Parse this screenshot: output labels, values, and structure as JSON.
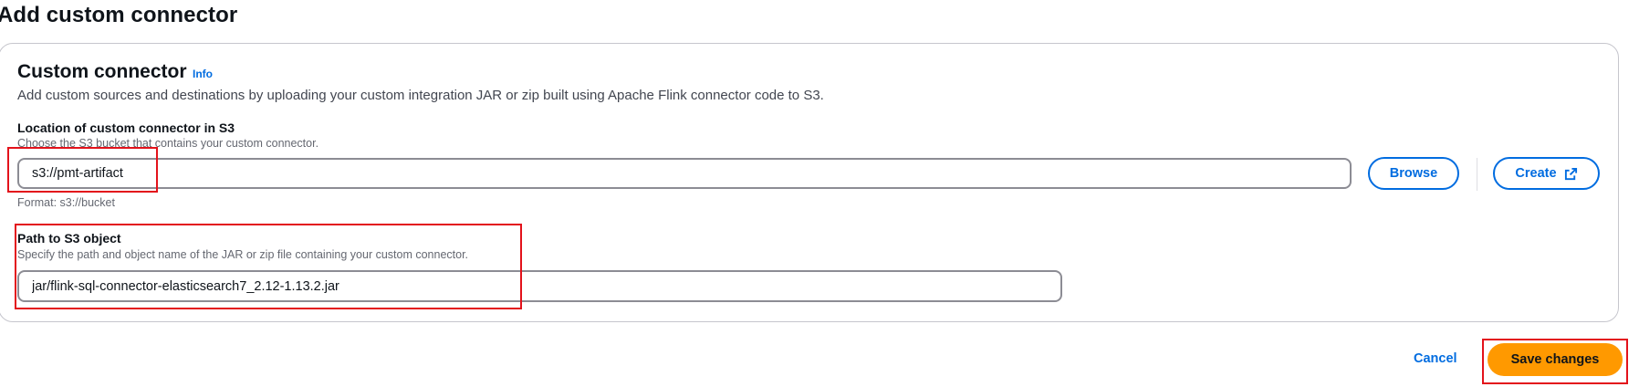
{
  "page": {
    "title": "Add custom connector"
  },
  "section": {
    "title": "Custom connector",
    "info_label": "Info",
    "description": "Add custom sources and destinations by uploading your custom integration JAR or zip built using Apache Flink connector code to S3."
  },
  "location_field": {
    "label": "Location of custom connector in S3",
    "description": "Choose the S3 bucket that contains your custom connector.",
    "value": "s3://pmt-artifact",
    "format_hint": "Format: s3://bucket",
    "browse_label": "Browse",
    "create_label": "Create"
  },
  "path_field": {
    "label": "Path to S3 object",
    "description": "Specify the path and object name of the JAR or zip file containing your custom connector.",
    "value": "jar/flink-sql-connector-elasticsearch7_2.12-1.13.2.jar"
  },
  "footer": {
    "cancel_label": "Cancel",
    "save_label": "Save changes"
  },
  "icons": {
    "external": "external-link-icon"
  },
  "colors": {
    "accent": "#006ce0",
    "primary_button": "#ff9900",
    "highlight": "#e3121b",
    "border": "#8c8c94"
  }
}
